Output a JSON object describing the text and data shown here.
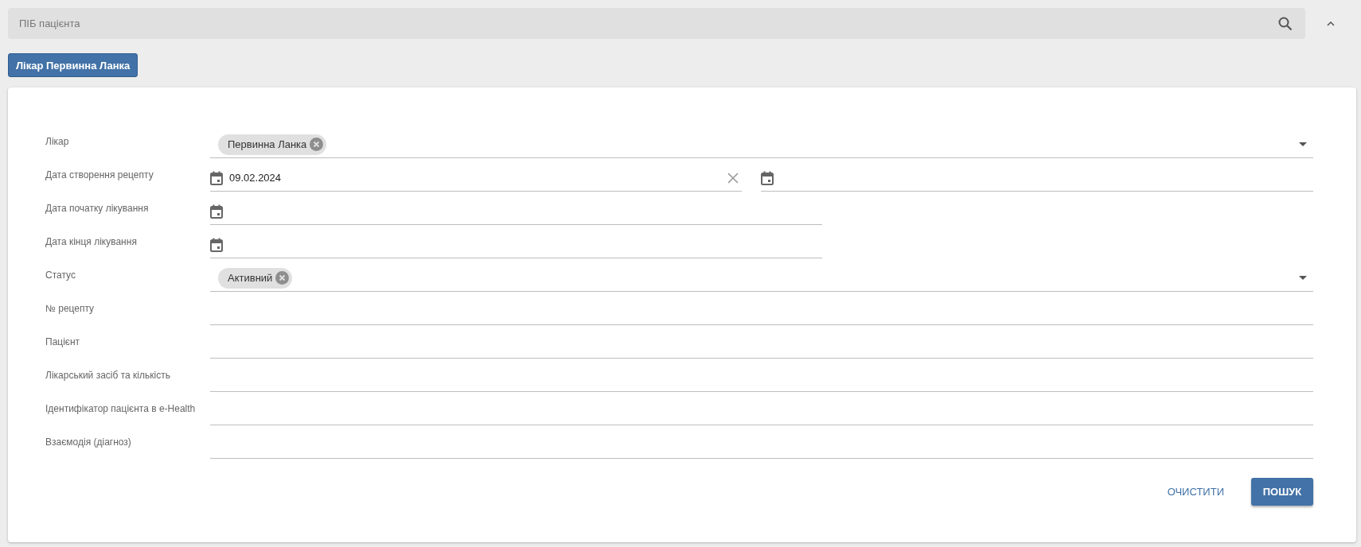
{
  "search": {
    "placeholder": "ПІБ пацієнта"
  },
  "filter_tags": [
    "Лікар Первинна Ланка"
  ],
  "form": {
    "fields": [
      {
        "kind": "chips",
        "label": "Лікар",
        "chips": [
          "Первинна Ланка"
        ]
      },
      {
        "kind": "date_range",
        "label": "Дата створення рецепту",
        "from": "09.02.2024"
      },
      {
        "kind": "date",
        "label": "Дата початку лікування"
      },
      {
        "kind": "date",
        "label": "Дата кінця лікування"
      },
      {
        "kind": "chips",
        "label": "Статус",
        "chips": [
          "Активний"
        ]
      },
      {
        "kind": "text",
        "label": "№ рецепту"
      },
      {
        "kind": "text",
        "label": "Пацієнт"
      },
      {
        "kind": "text",
        "label": "Лікарський засіб та кількість"
      },
      {
        "kind": "text",
        "label": "Ідентифікатор пацієнта в e-Health"
      },
      {
        "kind": "text",
        "label": "Взаємодія (діагноз)"
      }
    ],
    "buttons": [
      {
        "kind": "text",
        "label": "ОЧИСТИТИ"
      },
      {
        "kind": "primary",
        "label": "ПОШУК"
      }
    ]
  }
}
